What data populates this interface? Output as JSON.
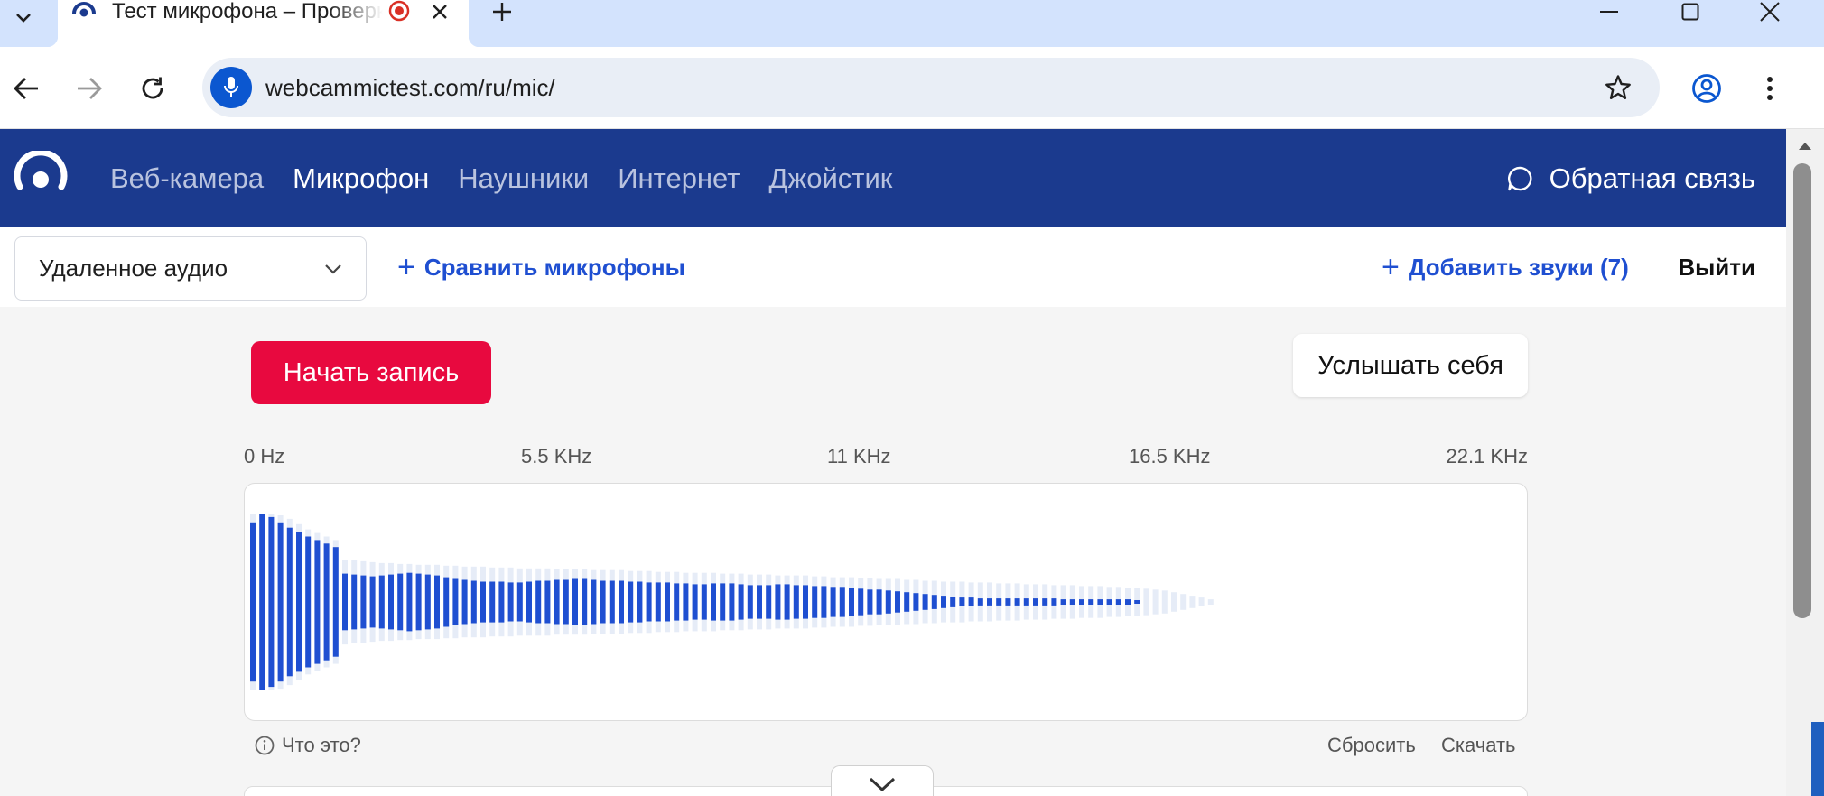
{
  "browser": {
    "tab_title": "Тест микрофона – Проверка микрофона онлайн",
    "url": "webcammictest.com/ru/mic/",
    "icons": [
      "chevron-down-icon",
      "site-favicon",
      "recording-icon",
      "close-icon",
      "plus-icon",
      "minimize-icon",
      "maximize-icon",
      "close-window-icon",
      "back-icon",
      "forward-icon",
      "reload-icon",
      "microphone-icon",
      "star-icon",
      "profile-icon",
      "more-icon"
    ]
  },
  "site_nav": {
    "items": [
      {
        "label": "Веб-камера",
        "active": false
      },
      {
        "label": "Микрофон",
        "active": true
      },
      {
        "label": "Наушники",
        "active": false
      },
      {
        "label": "Интернет",
        "active": false
      },
      {
        "label": "Джойстик",
        "active": false
      }
    ],
    "feedback_label": "Обратная связь",
    "colors": {
      "nav_bg": "#1b3a8e",
      "inactive": "#b9c3df",
      "active": "#ffffff"
    }
  },
  "subbar": {
    "device_select": "Удаленное аудио",
    "compare_label": "Сравнить микрофоны",
    "add_sounds_label": "Добавить звуки (7)",
    "logout_label": "Выйти",
    "link_color": "#1f4fd1"
  },
  "actions": {
    "record_label": "Начать запись",
    "record_color": "#e8093f",
    "hear_self_label": "Услышать себя"
  },
  "frequency_axis": {
    "ticks": [
      "0 Hz",
      "5.5 KHz",
      "11 KHz",
      "16.5 KHz",
      "22.1 KHz"
    ]
  },
  "footer": {
    "what_is_this": "Что это?",
    "reset_label": "Сбросить",
    "download_label": "Скачать"
  },
  "chart_data": {
    "type": "bar",
    "x_range": [
      0,
      22.1
    ],
    "x_unit": "KHz",
    "x_ticks": [
      "0 Hz",
      "5.5 KHz",
      "11 KHz",
      "16.5 KHz",
      "22.1 KHz"
    ],
    "colors": {
      "current": "#1f4fd1",
      "peak": "#e6ecf7"
    },
    "series": [
      {
        "values": [
          0.9,
          1.0,
          0.96,
          0.9,
          0.84,
          0.79,
          0.74,
          0.7,
          0.66,
          0.62,
          0.32,
          0.31,
          0.3,
          0.29,
          0.3,
          0.31,
          0.32,
          0.33,
          0.32,
          0.31,
          0.3,
          0.28,
          0.26,
          0.25,
          0.24,
          0.23,
          0.23,
          0.23,
          0.22,
          0.22,
          0.23,
          0.24,
          0.24,
          0.25,
          0.25,
          0.26,
          0.26,
          0.25,
          0.24,
          0.24,
          0.24,
          0.23,
          0.23,
          0.22,
          0.22,
          0.22,
          0.21,
          0.21,
          0.2,
          0.2,
          0.21,
          0.21,
          0.21,
          0.2,
          0.19,
          0.19,
          0.19,
          0.2,
          0.2,
          0.19,
          0.19,
          0.18,
          0.18,
          0.17,
          0.17,
          0.16,
          0.15,
          0.14,
          0.14,
          0.13,
          0.12,
          0.11,
          0.1,
          0.09,
          0.08,
          0.07,
          0.06,
          0.05,
          0.05,
          0.04,
          0.04,
          0.04,
          0.04,
          0.04,
          0.04,
          0.04,
          0.04,
          0.04,
          0.03,
          0.03,
          0.03,
          0.03,
          0.03,
          0.03,
          0.03,
          0.03,
          0.02,
          0.0,
          0.0,
          0.0,
          0.0,
          0.0,
          0.0,
          0.0,
          0.0
        ]
      },
      {
        "values": [
          1.0,
          1.0,
          1.0,
          0.98,
          0.94,
          0.88,
          0.82,
          0.78,
          0.74,
          0.7,
          0.48,
          0.47,
          0.46,
          0.45,
          0.44,
          0.44,
          0.43,
          0.43,
          0.42,
          0.42,
          0.42,
          0.41,
          0.41,
          0.4,
          0.4,
          0.4,
          0.39,
          0.39,
          0.39,
          0.38,
          0.38,
          0.38,
          0.38,
          0.37,
          0.37,
          0.37,
          0.37,
          0.36,
          0.36,
          0.36,
          0.36,
          0.35,
          0.35,
          0.35,
          0.34,
          0.34,
          0.34,
          0.33,
          0.33,
          0.33,
          0.33,
          0.32,
          0.32,
          0.32,
          0.31,
          0.31,
          0.31,
          0.3,
          0.3,
          0.3,
          0.3,
          0.29,
          0.29,
          0.28,
          0.28,
          0.28,
          0.27,
          0.27,
          0.26,
          0.26,
          0.26,
          0.25,
          0.25,
          0.24,
          0.24,
          0.23,
          0.23,
          0.23,
          0.22,
          0.22,
          0.22,
          0.21,
          0.21,
          0.21,
          0.2,
          0.2,
          0.2,
          0.19,
          0.19,
          0.19,
          0.18,
          0.18,
          0.18,
          0.17,
          0.17,
          0.16,
          0.16,
          0.15,
          0.14,
          0.13,
          0.11,
          0.09,
          0.07,
          0.05,
          0.03
        ]
      }
    ]
  }
}
